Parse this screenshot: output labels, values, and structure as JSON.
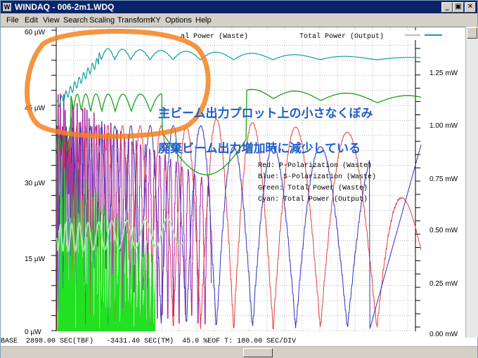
{
  "window": {
    "title": "WINDAQ - 006-2m1.WDQ",
    "icon": "windaq-app-icon"
  },
  "titlebar_buttons": [
    "_",
    "▣",
    "✕"
  ],
  "menu": [
    "File",
    "Edit",
    "View",
    "Search",
    "Scaling",
    "Transform",
    "XY",
    "Options",
    "Help"
  ],
  "left_axis": [
    "60 µW",
    "45 µW",
    "30 µW",
    "15 µW",
    "0 µW"
  ],
  "right_axis": [
    "1.25 mW",
    "1.00 mW",
    "0.75 mW",
    "0.50 mW",
    "0.25 mW",
    "0.00 mW"
  ],
  "header_legend": {
    "left": "al Power (Waste)",
    "right": "Total Power (Output)"
  },
  "legend": [
    "Red: P-Polarization (Waste)",
    "Blue: S-Polarization (Waste)",
    "Green: Total Power (Waste)",
    "Cyan: Total Power (Output)"
  ],
  "annotation": {
    "line1": "主ビーム出力プロット上の小さなくぼみ",
    "line2": "廃棄ビーム出力増加時に減少している"
  },
  "status": {
    "base": "BASE",
    "tbf": "2898.00 SEC(TBF)",
    "tm": "-3431.40 SEC(TM)",
    "eof": "45.0 %EOF",
    "t": "T: 180.00 SEC/DIV"
  },
  "colors": {
    "red": "#e04040",
    "blue": "#3030c0",
    "green": "#1aa01a",
    "cyan": "#10a0a0",
    "magenta": "#a020a0",
    "highlight": "#f58220",
    "annotation": "#1e5fc8"
  }
}
